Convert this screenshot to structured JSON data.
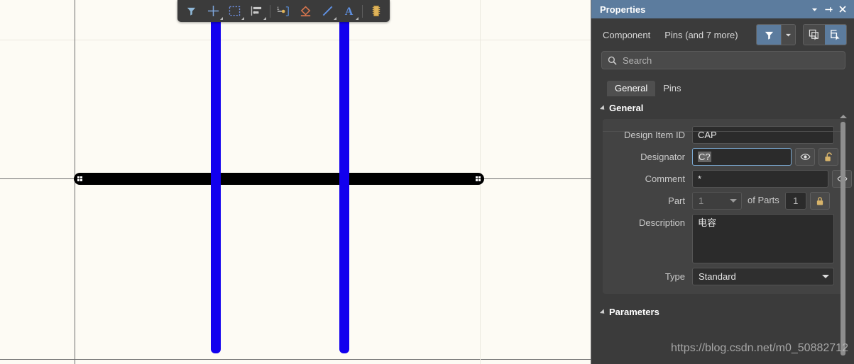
{
  "app": {
    "canvas_bg": "#fdfbf4",
    "grid_color": "#6e6e6e",
    "panel_bg": "#3b3b3b",
    "accent": "#5c7c9e"
  },
  "canvas": {
    "name": "schematic-editor-canvas",
    "component": "capacitor",
    "plate_color": "#000000",
    "pin_color": "#1200ee"
  },
  "toolbar": {
    "name": "schematic-placement-toolbar",
    "items": [
      {
        "icon": "filter-funnel-icon",
        "label": "Filter",
        "has_dropdown": false
      },
      {
        "icon": "crosshair-icon",
        "label": "Place Part",
        "has_dropdown": true
      },
      {
        "icon": "dashed-rectangle-icon",
        "label": "Rectangle Select",
        "has_dropdown": true
      },
      {
        "icon": "align-left-icon",
        "label": "Align",
        "has_dropdown": true
      },
      {
        "icon": "place-pin-icon",
        "label": "Place Pin",
        "has_dropdown": false
      },
      {
        "icon": "power-port-icon",
        "label": "Place GND Power Port",
        "has_dropdown": false
      },
      {
        "icon": "line-icon",
        "label": "Place Line",
        "has_dropdown": true
      },
      {
        "icon": "text-a-icon",
        "label": "Place Text String",
        "has_dropdown": true
      },
      {
        "icon": "ic-chip-icon",
        "label": "Place IEEE Symbol",
        "has_dropdown": false
      }
    ]
  },
  "panel": {
    "title": "Properties",
    "titlebar_buttons": [
      {
        "icon": "chevron-down-icon",
        "label": "Panel Menu"
      },
      {
        "icon": "pin-icon",
        "label": "Dock / Undock"
      },
      {
        "icon": "close-icon",
        "label": "Close"
      }
    ],
    "object_row": {
      "object_label": "Component",
      "scope_label": "Pins (and 7 more)",
      "filter_button": "filter-funnel-icon",
      "filter_dropdown": "chevron-down-icon",
      "select_button": "select-all-icon",
      "select_touching_button": "select-touching-icon"
    },
    "search": {
      "icon": "search-icon",
      "placeholder": "Search",
      "value": ""
    },
    "tabs": [
      {
        "label": "General",
        "selected": true
      },
      {
        "label": "Pins",
        "selected": false
      }
    ],
    "sections": [
      {
        "label": "General",
        "expanded": true
      },
      {
        "label": "Parameters",
        "expanded": true
      }
    ],
    "fields": {
      "design_item_id": {
        "label": "Design Item ID",
        "value": "CAP"
      },
      "designator": {
        "label": "Designator",
        "value": "C?",
        "focused": true,
        "selected": true,
        "visible_icon": "eye-icon",
        "lock_icon": "unlock-icon"
      },
      "comment": {
        "label": "Comment",
        "value": "*",
        "visible_icon": "eye-icon",
        "lock_icon": "unlock-icon"
      },
      "part": {
        "label": "Part",
        "value": "1",
        "of_parts_label": "of Parts",
        "of_parts_value": "1",
        "lock_icon": "lock-icon"
      },
      "description": {
        "label": "Description",
        "value": "电容"
      },
      "type": {
        "label": "Type",
        "value": "Standard",
        "dropdown_icon": "chevron-down-icon"
      }
    },
    "scrollbar": {
      "up_arrow": "caret-up-icon"
    },
    "bottom_buttons": [
      {
        "label": "",
        "highlighted": false
      },
      {
        "label": "",
        "highlighted": true
      },
      {
        "label": "",
        "highlighted": false
      }
    ]
  },
  "watermark": {
    "text": "https://blog.csdn.net/m0_50882712"
  }
}
